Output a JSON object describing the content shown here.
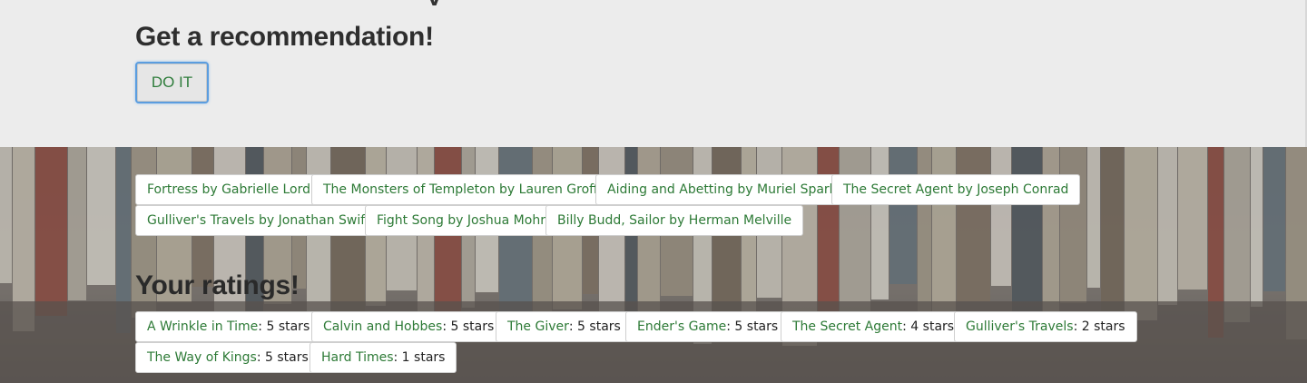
{
  "recommend": {
    "heading": "Get a recommendation!",
    "button_label": "DO IT",
    "cutoff_glyph": "y"
  },
  "recommendations": [
    "Fortress by Gabrielle Lord",
    "The Monsters of Templeton by Lauren Groff",
    "Aiding and Abetting by Muriel Spark",
    "The Secret Agent by Joseph Conrad",
    "Gulliver's Travels by Jonathan Swift",
    "Fight Song by Joshua Mohr",
    "Billy Budd, Sailor by Herman Melville"
  ],
  "ratings": {
    "heading": "Your ratings!",
    "items": [
      {
        "title": "A Wrinkle in Time",
        "rating": ": 5 stars"
      },
      {
        "title": "Calvin and Hobbes",
        "rating": ": 5 stars"
      },
      {
        "title": "The Giver",
        "rating": ": 5 stars"
      },
      {
        "title": "Ender's Game",
        "rating": ": 5 stars"
      },
      {
        "title": "The Secret Agent",
        "rating": ": 4 stars"
      },
      {
        "title": "Gulliver's Travels",
        "rating": ": 2 stars"
      },
      {
        "title": "The Way of Kings",
        "rating": ": 5 stars"
      },
      {
        "title": "Hard Times",
        "rating": ": 1 stars"
      }
    ]
  },
  "colors": {
    "link_green": "#2d7a36",
    "top_bg": "#ececec",
    "focus_blue": "#5b9ddf"
  }
}
